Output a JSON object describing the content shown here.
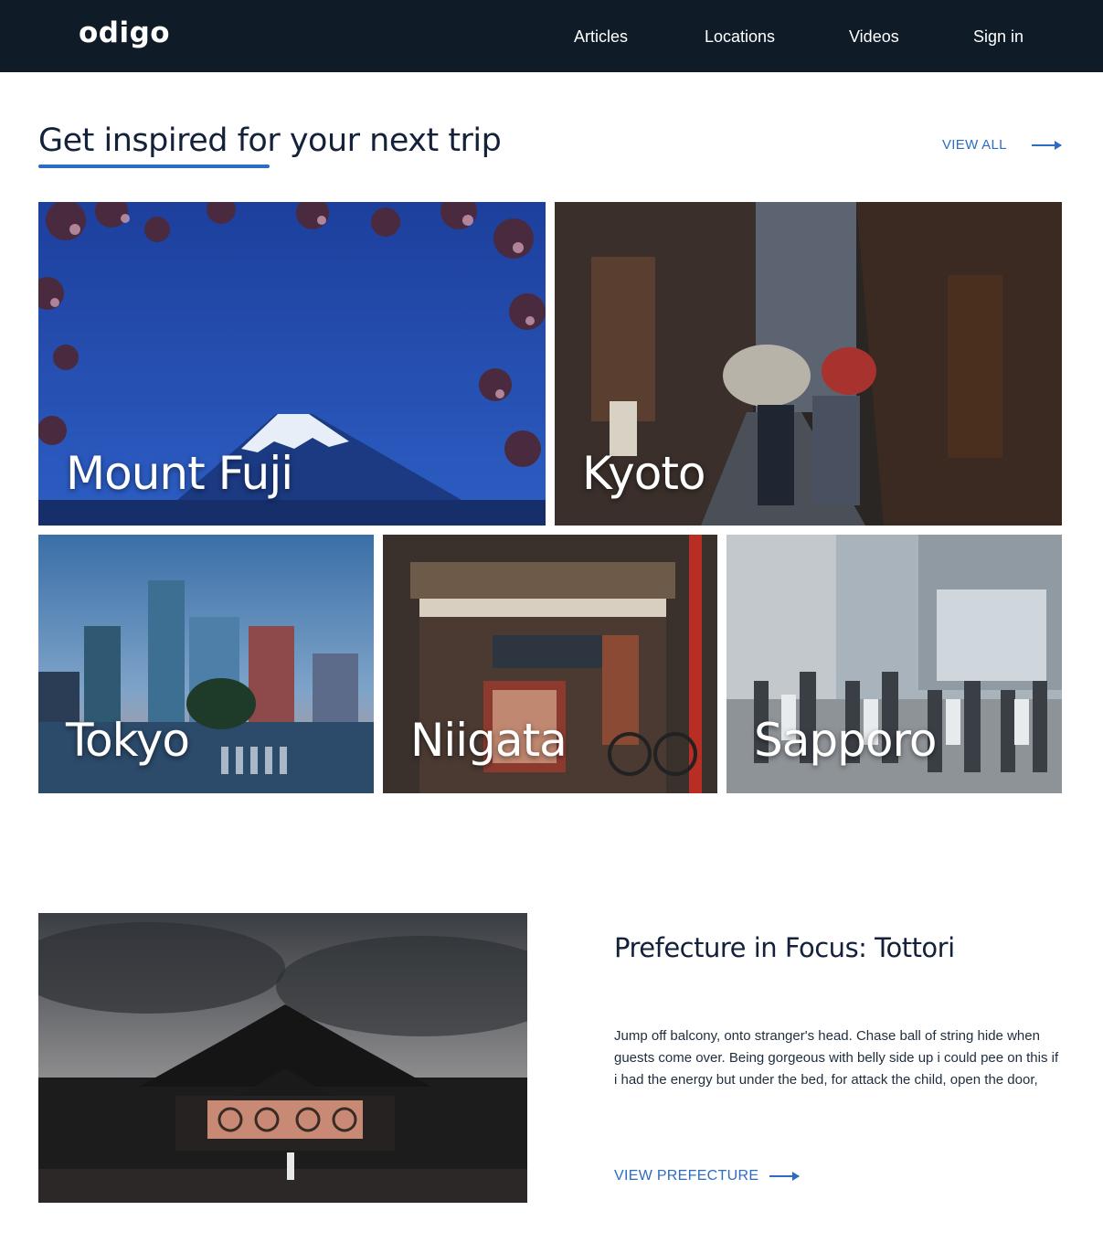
{
  "header": {
    "logo": "odigo",
    "nav": [
      "Articles",
      "Locations",
      "Videos",
      "Sign in"
    ]
  },
  "inspire": {
    "title": "Get inspired for your next trip",
    "view_all": "VIEW ALL",
    "destinations": [
      "Mount Fuji",
      "Kyoto",
      "Tokyo",
      "Niigata",
      "Sapporo"
    ]
  },
  "focus": {
    "title": "Prefecture in Focus: Tottori",
    "body": "Jump off balcony, onto stranger's head. Chase ball of string hide when guests come over. Being gorgeous with belly side up i could pee on this if i had the energy but under the bed, for attack the child, open the door,",
    "cta": "VIEW PREFECTURE"
  },
  "colors": {
    "header_bg": "#0f1b26",
    "accent": "#2c6cc4",
    "heading": "#13223a"
  }
}
